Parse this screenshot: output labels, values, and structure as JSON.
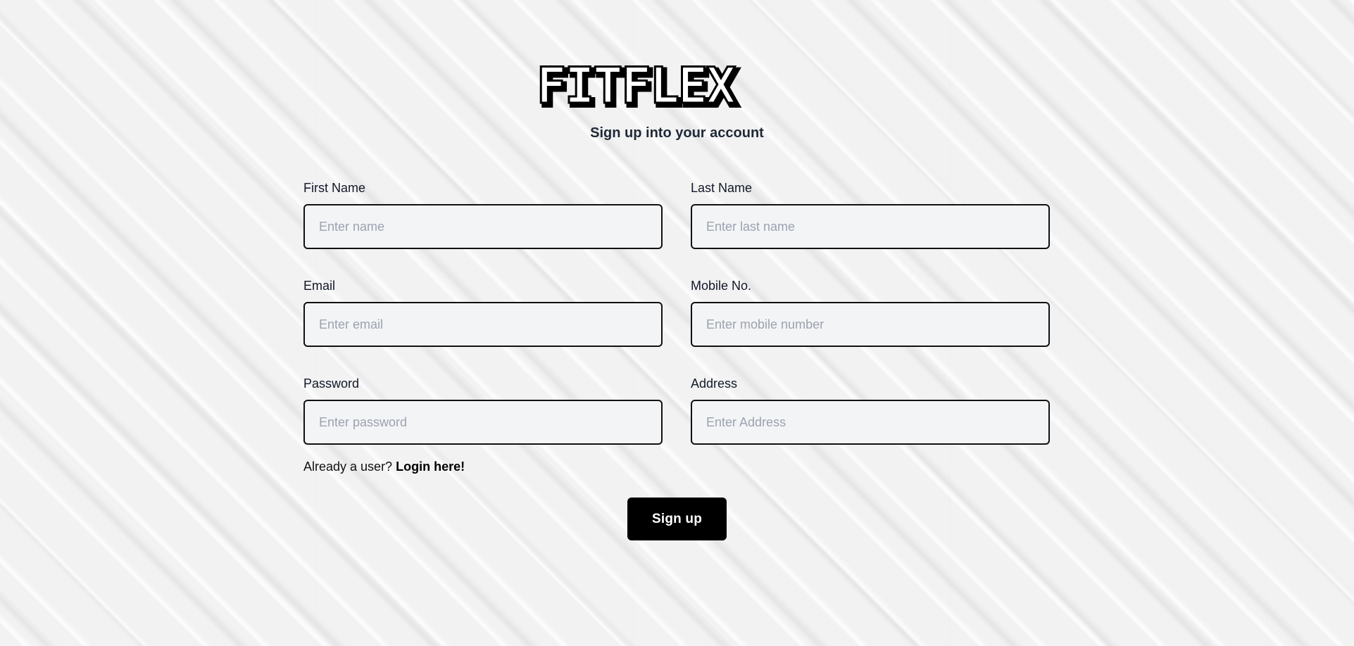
{
  "brand": {
    "logo_text": "FITFLEX"
  },
  "subtitle": "Sign up into your account",
  "form": {
    "first_name": {
      "label": "First Name",
      "placeholder": "Enter name",
      "value": ""
    },
    "last_name": {
      "label": "Last Name",
      "placeholder": "Enter last name",
      "value": ""
    },
    "email": {
      "label": "Email",
      "placeholder": "Enter email",
      "value": ""
    },
    "mobile": {
      "label": "Mobile No.",
      "placeholder": "Enter mobile number",
      "value": ""
    },
    "password": {
      "label": "Password",
      "placeholder": "Enter password",
      "value": ""
    },
    "address": {
      "label": "Address",
      "placeholder": "Enter Address",
      "value": ""
    }
  },
  "login_prompt": {
    "text": "Already a user?",
    "link_label": "Login here!"
  },
  "signup_button": {
    "label": "Sign up"
  },
  "colors": {
    "button_background": "#000000",
    "input_border": "#111111",
    "input_background": "#f3f4f6",
    "page_background": "#f2f2f3"
  }
}
